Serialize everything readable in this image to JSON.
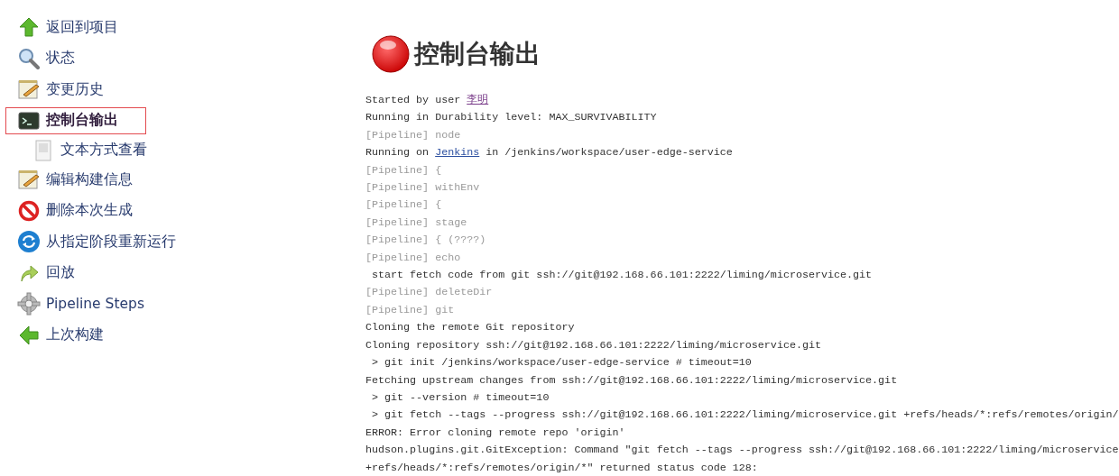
{
  "sidebar": {
    "items": [
      {
        "kind": "back",
        "label": "返回到项目",
        "selected": false,
        "highlighted": false
      },
      {
        "kind": "status",
        "label": "状态",
        "selected": false,
        "highlighted": false
      },
      {
        "kind": "changes",
        "label": "变更历史",
        "selected": false,
        "highlighted": false
      },
      {
        "kind": "console",
        "label": "控制台输出",
        "selected": true,
        "highlighted": true,
        "children": [
          {
            "kind": "text",
            "label": "文本方式查看",
            "selected": false,
            "highlighted": false
          }
        ]
      },
      {
        "kind": "edit",
        "label": "编辑构建信息",
        "selected": false,
        "highlighted": false
      },
      {
        "kind": "delete",
        "label": "删除本次生成",
        "selected": false,
        "highlighted": false
      },
      {
        "kind": "restart",
        "label": "从指定阶段重新运行",
        "selected": false,
        "highlighted": false
      },
      {
        "kind": "replay",
        "label": "回放",
        "selected": false,
        "highlighted": false
      },
      {
        "kind": "steps",
        "label": "Pipeline Steps",
        "selected": false,
        "highlighted": false
      },
      {
        "kind": "previous",
        "label": "上次构建",
        "selected": false,
        "highlighted": false
      }
    ]
  },
  "page": {
    "title": "控制台输出",
    "failed": true
  },
  "console": {
    "lines": [
      {
        "kind": "plain",
        "parts": [
          {
            "kind": "text",
            "text": "Started by user "
          },
          {
            "kind": "link",
            "text": "李明",
            "visited": true
          }
        ]
      },
      {
        "kind": "plain",
        "parts": [
          {
            "kind": "text",
            "text": "Running in Durability level: MAX_SURVIVABILITY"
          }
        ]
      },
      {
        "kind": "pipeline",
        "parts": [
          {
            "kind": "text",
            "text": "[Pipeline] node"
          }
        ]
      },
      {
        "kind": "plain",
        "parts": [
          {
            "kind": "text",
            "text": "Running on "
          },
          {
            "kind": "link",
            "text": "Jenkins",
            "visited": false
          },
          {
            "kind": "text",
            "text": " in /jenkins/workspace/user-edge-service"
          }
        ]
      },
      {
        "kind": "pipeline",
        "parts": [
          {
            "kind": "text",
            "text": "[Pipeline] {"
          }
        ]
      },
      {
        "kind": "pipeline",
        "parts": [
          {
            "kind": "text",
            "text": "[Pipeline] withEnv"
          }
        ]
      },
      {
        "kind": "pipeline",
        "parts": [
          {
            "kind": "text",
            "text": "[Pipeline] {"
          }
        ]
      },
      {
        "kind": "pipeline",
        "parts": [
          {
            "kind": "text",
            "text": "[Pipeline] stage"
          }
        ]
      },
      {
        "kind": "pipeline",
        "parts": [
          {
            "kind": "text",
            "text": "[Pipeline] { (????)"
          }
        ]
      },
      {
        "kind": "pipeline",
        "parts": [
          {
            "kind": "text",
            "text": "[Pipeline] echo"
          }
        ]
      },
      {
        "kind": "plain",
        "parts": [
          {
            "kind": "text",
            "text": " start fetch code from git ssh://git@192.168.66.101:2222/liming/microservice.git"
          }
        ]
      },
      {
        "kind": "pipeline",
        "parts": [
          {
            "kind": "text",
            "text": "[Pipeline] deleteDir"
          }
        ]
      },
      {
        "kind": "pipeline",
        "parts": [
          {
            "kind": "text",
            "text": "[Pipeline] git"
          }
        ]
      },
      {
        "kind": "plain",
        "parts": [
          {
            "kind": "text",
            "text": "Cloning the remote Git repository"
          }
        ]
      },
      {
        "kind": "plain",
        "parts": [
          {
            "kind": "text",
            "text": "Cloning repository ssh://git@192.168.66.101:2222/liming/microservice.git"
          }
        ]
      },
      {
        "kind": "plain",
        "parts": [
          {
            "kind": "text",
            "text": " > git init /jenkins/workspace/user-edge-service # timeout=10"
          }
        ]
      },
      {
        "kind": "plain",
        "parts": [
          {
            "kind": "text",
            "text": "Fetching upstream changes from ssh://git@192.168.66.101:2222/liming/microservice.git"
          }
        ]
      },
      {
        "kind": "plain",
        "parts": [
          {
            "kind": "text",
            "text": " > git --version # timeout=10"
          }
        ]
      },
      {
        "kind": "plain",
        "parts": [
          {
            "kind": "text",
            "text": " > git fetch --tags --progress ssh://git@192.168.66.101:2222/liming/microservice.git +refs/heads/*:refs/remotes/origin/"
          }
        ]
      },
      {
        "kind": "plain",
        "parts": [
          {
            "kind": "text",
            "text": "ERROR: Error cloning remote repo 'origin'"
          }
        ]
      },
      {
        "kind": "plain",
        "parts": [
          {
            "kind": "text",
            "text": "hudson.plugins.git.GitException: Command \"git fetch --tags --progress ssh://git@192.168.66.101:2222/liming/microservice"
          }
        ]
      },
      {
        "kind": "plain",
        "parts": [
          {
            "kind": "text",
            "text": "+refs/heads/*:refs/remotes/origin/*\" returned status code 128:"
          }
        ]
      }
    ]
  }
}
